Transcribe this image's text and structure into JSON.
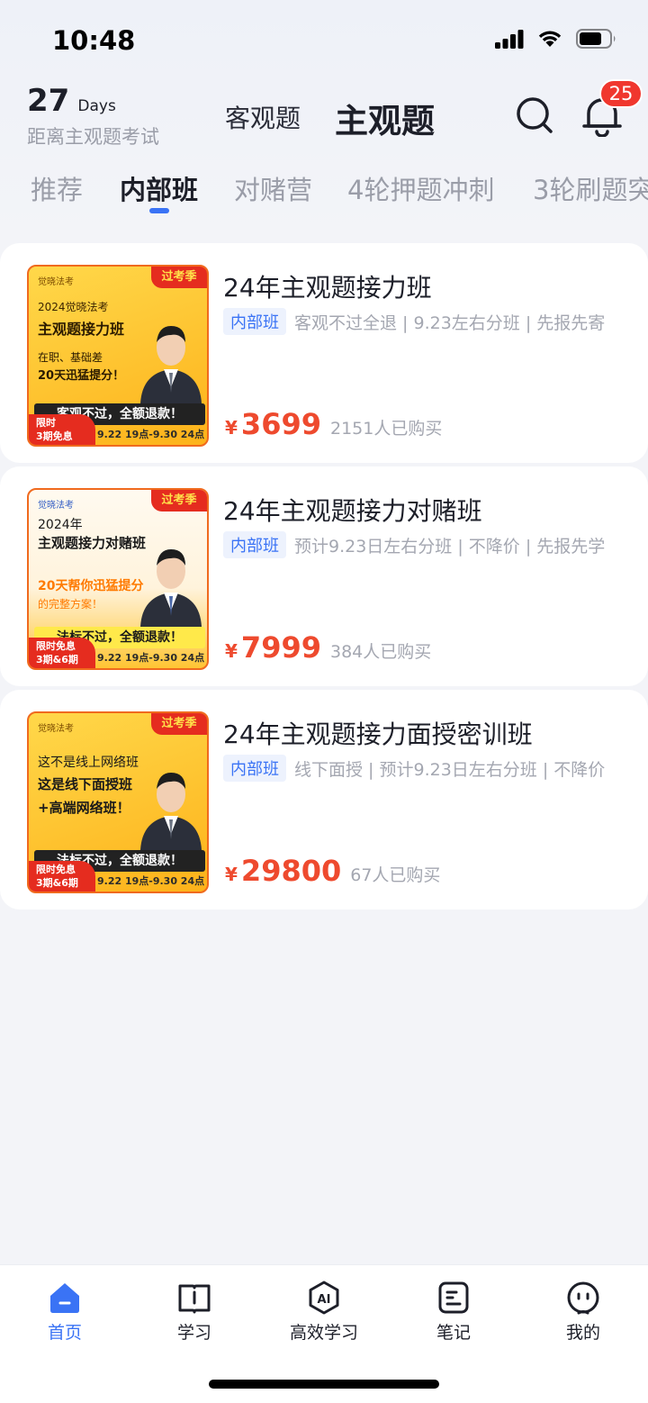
{
  "status_bar": {
    "time": "10:48"
  },
  "header": {
    "countdown_number": "27",
    "countdown_unit": "Days",
    "countdown_label": "距离主观题考试",
    "mode_tabs": [
      "客观题",
      "主观题"
    ],
    "active_mode": "主观题",
    "notification_count": "25"
  },
  "category_tabs": [
    "推荐",
    "内部班",
    "对赌营",
    "4轮押题冲刺",
    "3轮刷题突"
  ],
  "active_category": "内部班",
  "courses": [
    {
      "title": "24年主观题接力班",
      "tag": "内部班",
      "desc": "客观不过全退 | 9.23左右分班 | 先报先寄",
      "currency": "¥",
      "price": "3699",
      "buyers": "2151人已购买",
      "thumb": {
        "brand": "觉晓法考",
        "ribbon": "过考季",
        "line1": "2024觉晓法考",
        "line2": "主观题接力班",
        "line3": "在职、基础差",
        "line4": "20天迅猛提分！",
        "refund": "客观不过，全额退款！",
        "limit_line1": "限时",
        "limit_line2": "3期免息",
        "date": "9.22 19点-9.30 24点",
        "color": "#fdbf1f"
      }
    },
    {
      "title": "24年主观题接力对赌班",
      "tag": "内部班",
      "desc": "预计9.23日左右分班 | 不降价 | 先报先学",
      "currency": "¥",
      "price": "7999",
      "buyers": "384人已购买",
      "thumb": {
        "brand": "觉晓法考",
        "ribbon": "过考季",
        "line1": "2024年",
        "line2": "主观题接力对赌班",
        "line3": "20天帮你迅猛提分",
        "line4": "的完整方案！",
        "refund": "法标不过，全额退款！",
        "limit_line1": "限时免息",
        "limit_line2": "3期&6期",
        "date": "9.22 19点-9.30 24点",
        "color": "#fff6e6"
      }
    },
    {
      "title": "24年主观题接力面授密训班",
      "tag": "内部班",
      "desc": "线下面授 | 预计9.23日左右分班 | 不降价",
      "currency": "¥",
      "price": "29800",
      "buyers": "67人已购买",
      "thumb": {
        "brand": "觉晓法考",
        "ribbon": "过考季",
        "line1": "这不是线上网络班",
        "line2": "这是线下面授班",
        "line3": "+高端网络班！",
        "line4": "",
        "refund": "法标不过，全额退款！",
        "limit_line1": "限时免息",
        "limit_line2": "3期&6期",
        "date": "9.22 19点-9.30 24点",
        "color": "#fdbf1f"
      }
    }
  ],
  "bottom_nav": [
    {
      "label": "首页",
      "icon": "home-icon"
    },
    {
      "label": "学习",
      "icon": "book-icon"
    },
    {
      "label": "高效学习",
      "icon": "ai-icon"
    },
    {
      "label": "笔记",
      "icon": "note-icon"
    },
    {
      "label": "我的",
      "icon": "profile-icon"
    }
  ],
  "active_nav": "首页",
  "colors": {
    "accent": "#3a73f5",
    "price": "#ee4a2e",
    "badge": "#f0372e"
  }
}
